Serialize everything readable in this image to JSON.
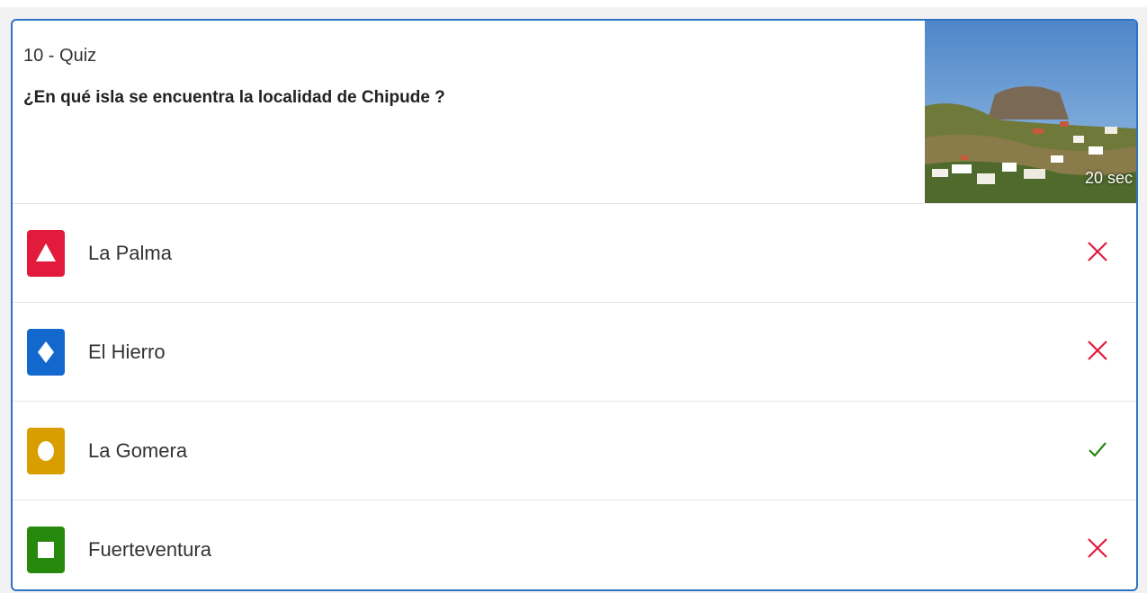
{
  "quiz": {
    "label": "10 - Quiz",
    "question": "¿En qué isla se encuentra la localidad de Chipude ?",
    "timer": "20 sec"
  },
  "answers": [
    {
      "label": "La Palma",
      "shape": "triangle-icon",
      "color": "#e21b3c",
      "result": "incorrect"
    },
    {
      "label": "El Hierro",
      "shape": "diamond-icon",
      "color": "#1368ce",
      "result": "incorrect"
    },
    {
      "label": "La Gomera",
      "shape": "circle-icon",
      "color": "#d89e00",
      "result": "correct"
    },
    {
      "label": "Fuerteventura",
      "shape": "square-icon",
      "color": "#26890c",
      "result": "incorrect"
    }
  ],
  "colors": {
    "border": "#2f73c4",
    "incorrect": "#e21b3c",
    "correct": "#26890c"
  }
}
